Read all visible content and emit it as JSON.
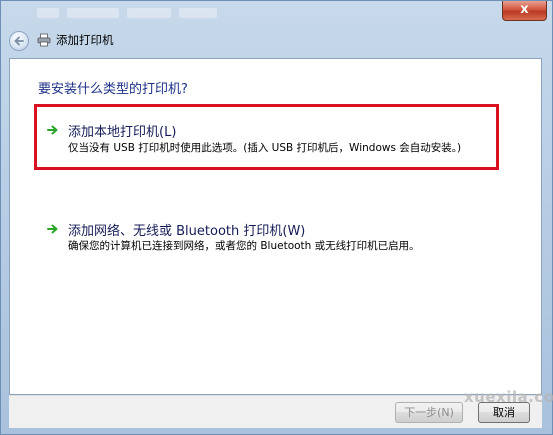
{
  "window": {
    "title": "添加打印机",
    "close_label": "x"
  },
  "main": {
    "question": "要安装什么类型的打印机?",
    "options": [
      {
        "label": "添加本地打印机(L)",
        "description": "仅当没有 USB 打印机时使用此选项。(插入 USB 打印机后，Windows 会自动安装。)"
      },
      {
        "label": "添加网络、无线或 Bluetooth 打印机(W)",
        "description": "确保您的计算机已连接到网络，或者您的 Bluetooth 或无线打印机已启用。"
      }
    ]
  },
  "footer": {
    "next_label": "下一步(N)",
    "cancel_label": "取消"
  },
  "watermark": {
    "site": "xuexila.com"
  },
  "colors": {
    "question_text": "#1e3287",
    "option_title_text": "#151c55",
    "highlight_border": "#d9101f",
    "arrow_green": "#2aa52a"
  },
  "icons": [
    "back-arrow-icon",
    "printer-icon",
    "green-arrow-icon",
    "close-icon"
  ]
}
